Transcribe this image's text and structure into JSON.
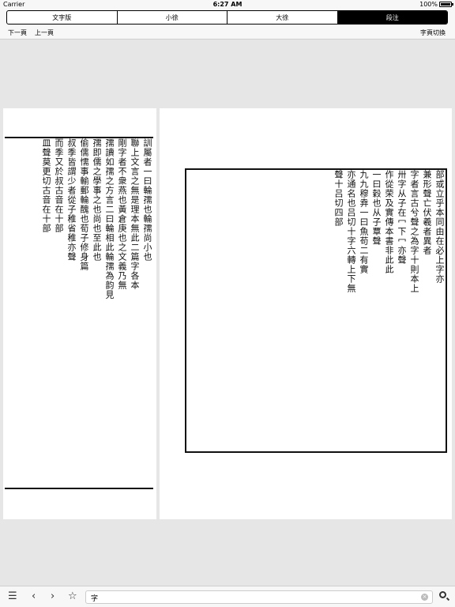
{
  "status": {
    "carrier": "Carrier",
    "time": "6:27 AM",
    "battery": "100%"
  },
  "tabs": [
    {
      "label": "文字版"
    },
    {
      "label": "小徐"
    },
    {
      "label": "大徐"
    },
    {
      "label": "段注"
    }
  ],
  "nav": {
    "prev": "下一頁",
    "next": "上一頁",
    "switch": "字頁切換"
  },
  "left_page_columns": [
    "訓屬者一曰輪孺也輪孺尚小也",
    "聯上文言之無是理本無此二篇字各本",
    "剛字者不衆燕也黃倉庚也之文義乃無",
    "孺讀如孺之方言二曰輪相此輪孺為韵見",
    "孺即儒之學事之也尚也至此也",
    "偷儒懦事輸郵輪醜也荀子修身篇",
    "叔季皆謂少者從子稚省稚亦聲",
    "而季又於叔古音在十部",
    "皿聲莫更切古音在十部"
  ],
  "right_page_columns": [
    "部或立乎本同由在必上字亦",
    "兼形聲亡伏羲者異者",
    "字者言古兮聲之為字十則本上",
    "卅字从子在冖下冖亦聲",
    "作從荣及實傳本書非此此",
    "一曰穀也从子覃聲",
    "九九穆弆一曰魚苟二有實",
    "亦通名也吕切十字六轉上下無",
    "聲十吕切四部"
  ],
  "search": {
    "value": "字"
  }
}
